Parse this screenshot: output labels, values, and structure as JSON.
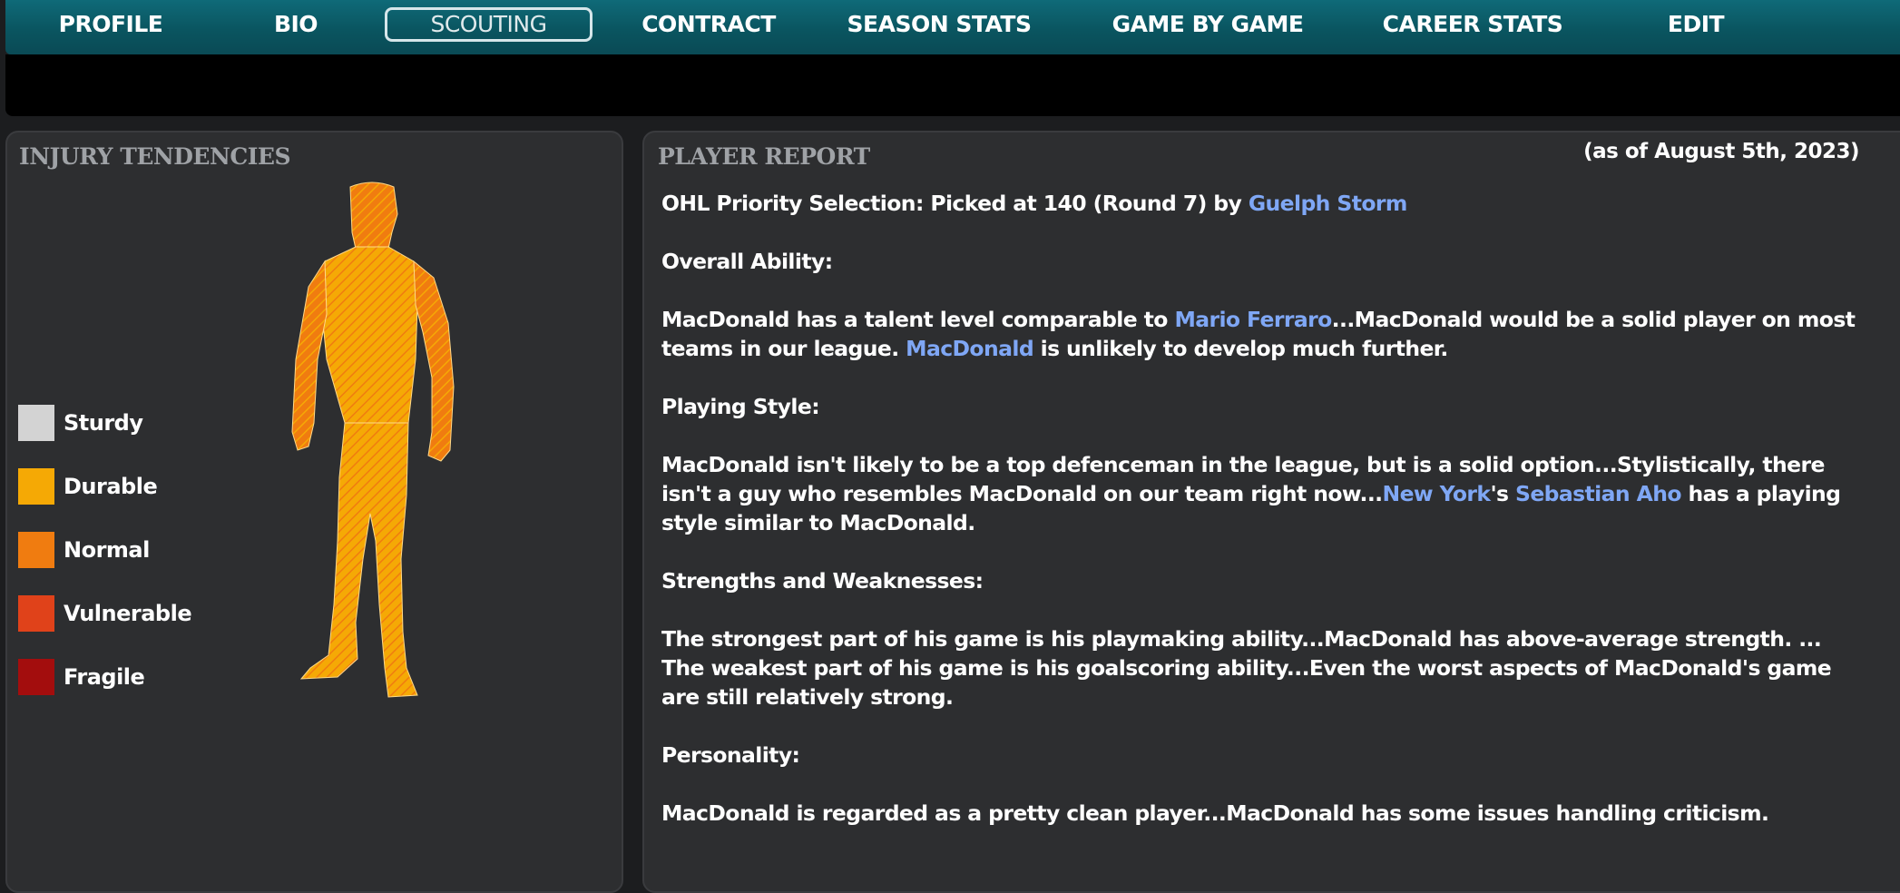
{
  "nav": {
    "items": [
      {
        "label": "PROFILE"
      },
      {
        "label": "BIO"
      },
      {
        "label": "SCOUTING",
        "active": true
      },
      {
        "label": "CONTRACT"
      },
      {
        "label": "SEASON STATS"
      },
      {
        "label": "GAME BY GAME"
      },
      {
        "label": "CAREER STATS"
      },
      {
        "label": "EDIT"
      }
    ]
  },
  "injury": {
    "title": "INJURY TENDENCIES",
    "legend": [
      {
        "label": "Sturdy",
        "color": "#d3d3d3"
      },
      {
        "label": "Durable",
        "color": "#f5a905"
      },
      {
        "label": "Normal",
        "color": "#f07c10"
      },
      {
        "label": "Vulnerable",
        "color": "#e0421a"
      },
      {
        "label": "Fragile",
        "color": "#a30d0d"
      }
    ],
    "figure_icon": "player-body-diagram-icon"
  },
  "report": {
    "title": "PLAYER REPORT",
    "as_of": "(as of August 5th, 2023)",
    "priority": {
      "prefix": "OHL Priority Selection: Picked at 140 (Round 7) by ",
      "team": "Guelph Storm"
    },
    "overall_heading": "Overall Ability:",
    "overall": {
      "t1": "MacDonald has a talent level comparable to ",
      "link1": "Mario Ferraro",
      "t2": "...MacDonald would be a solid player on most teams in our league. ",
      "link2": "MacDonald",
      "t3": " is unlikely to develop much further."
    },
    "style_heading": "Playing Style:",
    "style": {
      "t1": "MacDonald isn't likely to be a top defenceman in the league, but is a solid option...Stylistically, there isn't a guy who resembles MacDonald on our team right now...",
      "link1": "New York",
      "t2": "'s ",
      "link2": "Sebastian Aho",
      "t3": " has a playing style similar to MacDonald."
    },
    "sw_heading": "Strengths and Weaknesses:",
    "sw_text": "The strongest part of his game is his playmaking ability...MacDonald has above-average strength. ... The weakest part of his game is his goalscoring ability...Even the worst aspects of MacDonald's game are still relatively strong.",
    "personality_heading": "Personality:",
    "personality_text": "MacDonald is regarded as a pretty clean player...MacDonald has some issues handling criticism."
  }
}
